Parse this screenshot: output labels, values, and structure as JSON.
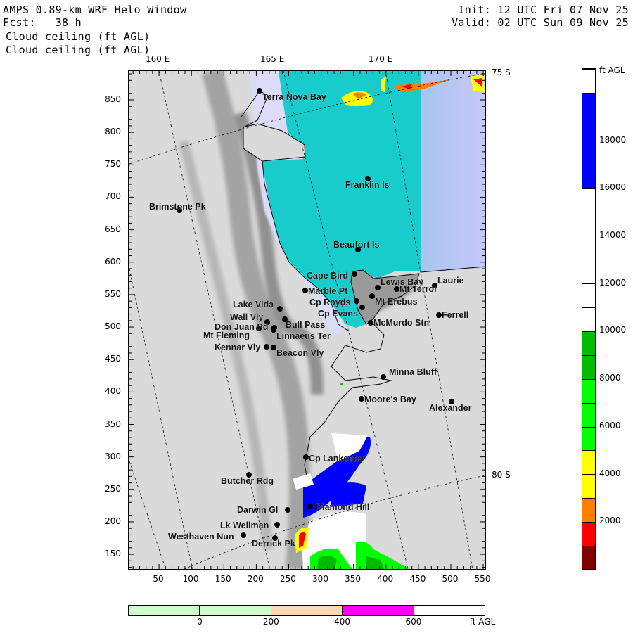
{
  "header": {
    "title": "AMPS 0.89-km WRF Helo Window",
    "forecast": "Fcst:   38 h",
    "init": "Init: 12 UTC Fri 07 Nov 25",
    "valid": "Valid: 02 UTC Sun 09 Nov 25",
    "field_line1": "Cloud ceiling (ft AGL)",
    "field_line2": "Cloud ceiling (ft AGL)"
  },
  "map": {
    "lon_labels": [
      "160 E",
      "165 E",
      "170 E"
    ],
    "lat_labels": [
      "75 S",
      "80 S"
    ],
    "y_ticks": [
      850,
      800,
      750,
      700,
      650,
      600,
      550,
      500,
      450,
      400,
      350,
      300,
      250,
      200,
      150
    ],
    "x_ticks": [
      50,
      100,
      150,
      200,
      250,
      300,
      350,
      400,
      450,
      500,
      550
    ],
    "stations": [
      "Terra Nova Bay",
      "Franklin Is",
      "Brimstone Pk",
      "Beaufort Is",
      "Cape Bird",
      "Lewis Bay",
      "Laurie",
      "Mt Terror",
      "Marble Pt",
      "Cp Royds",
      "Mt Erebus",
      "Lake Vida",
      "Cp Evans",
      "Ferrell",
      "Wall Vly",
      "Bull Pass",
      "McMurdo Stn",
      "Don Juan Pd",
      "Mt Fleming",
      "Linnaeus Ter",
      "Kennar Vly",
      "Beacon Vly",
      "Minna Bluff",
      "Moore's Bay",
      "Alexander",
      "Cp Lankester",
      "Butcher Rdg",
      "Darwin Gl",
      "Diamond Hill",
      "Lk Wellman",
      "Westhaven Nun",
      "Derrick Pk"
    ]
  },
  "colorbar": {
    "unit": "ft AGL",
    "labels": [
      "2000",
      "4000",
      "6000",
      "8000",
      "10000",
      "12000",
      "14000",
      "16000",
      "18000"
    ],
    "colors": [
      "#800000",
      "#ff0000",
      "#ff8000",
      "#ffff00",
      "#ffff00",
      "#00ff00",
      "#00ff00",
      "#00ff00",
      "#00bb00",
      "#00bb00",
      "#ffffff",
      "#ffffff",
      "#ffffff",
      "#ffffff",
      "#ffffff",
      "#ffffff",
      "#0000ff",
      "#0000ff",
      "#0000ff",
      "#0000ff",
      "#ffffff"
    ]
  },
  "terrain_bar": {
    "unit": "ft AGL",
    "labels": [
      "0",
      "200",
      "400",
      "600"
    ],
    "colors": [
      "#ccffcc",
      "#ccffcc",
      "#ffd9b3",
      "#ff00ff",
      "#ffffff"
    ]
  }
}
